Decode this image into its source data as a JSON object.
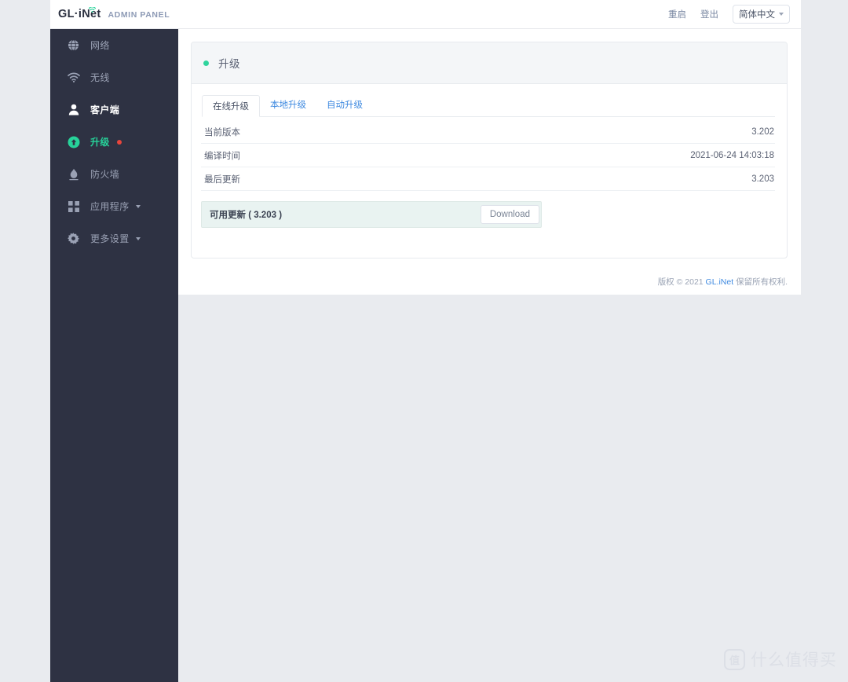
{
  "header": {
    "logo_text": "GL·iNet",
    "logo_icon": "wifi-signal-icon",
    "subtitle": "ADMIN PANEL",
    "reboot_label": "重启",
    "logout_label": "登出",
    "language_value": "简体中文",
    "language_caret_icon": "chevron-down-icon"
  },
  "sidebar": {
    "items": [
      {
        "label": "网络",
        "icon": "globe-icon",
        "state": "normal",
        "has_caret": false,
        "has_badge": false
      },
      {
        "label": "无线",
        "icon": "wifi-icon",
        "state": "normal",
        "has_caret": false,
        "has_badge": false
      },
      {
        "label": "客户端",
        "icon": "person-icon",
        "state": "active",
        "has_caret": false,
        "has_badge": false
      },
      {
        "label": "升级",
        "icon": "upload-circle-icon",
        "state": "upgrade",
        "has_caret": false,
        "has_badge": true
      },
      {
        "label": "防火墙",
        "icon": "flame-icon",
        "state": "normal",
        "has_caret": false,
        "has_badge": false
      },
      {
        "label": "应用程序",
        "icon": "grid-icon",
        "state": "normal",
        "has_caret": true,
        "has_badge": false
      },
      {
        "label": "更多设置",
        "icon": "gear-icon",
        "state": "normal",
        "has_caret": true,
        "has_badge": false
      }
    ]
  },
  "main": {
    "card_title": "升级",
    "status_dot_color": "#2fd49d",
    "tabs": [
      {
        "label": "在线升级",
        "active": true
      },
      {
        "label": "本地升级",
        "active": false
      },
      {
        "label": "自动升级",
        "active": false
      }
    ],
    "info_rows": [
      {
        "label": "当前版本",
        "value": "3.202"
      },
      {
        "label": "编译时间",
        "value": "2021-06-24 14:03:18"
      },
      {
        "label": "最后更新",
        "value": "3.203"
      }
    ],
    "update_banner": {
      "text": "可用更新 ( 3.203 )",
      "button_label": "Download"
    }
  },
  "footer": {
    "prefix": "版权 © 2021 ",
    "brand": "GL.iNet",
    "suffix": " 保留所有权利."
  },
  "watermark": {
    "badge_char": "值",
    "text": "什么值得买"
  }
}
